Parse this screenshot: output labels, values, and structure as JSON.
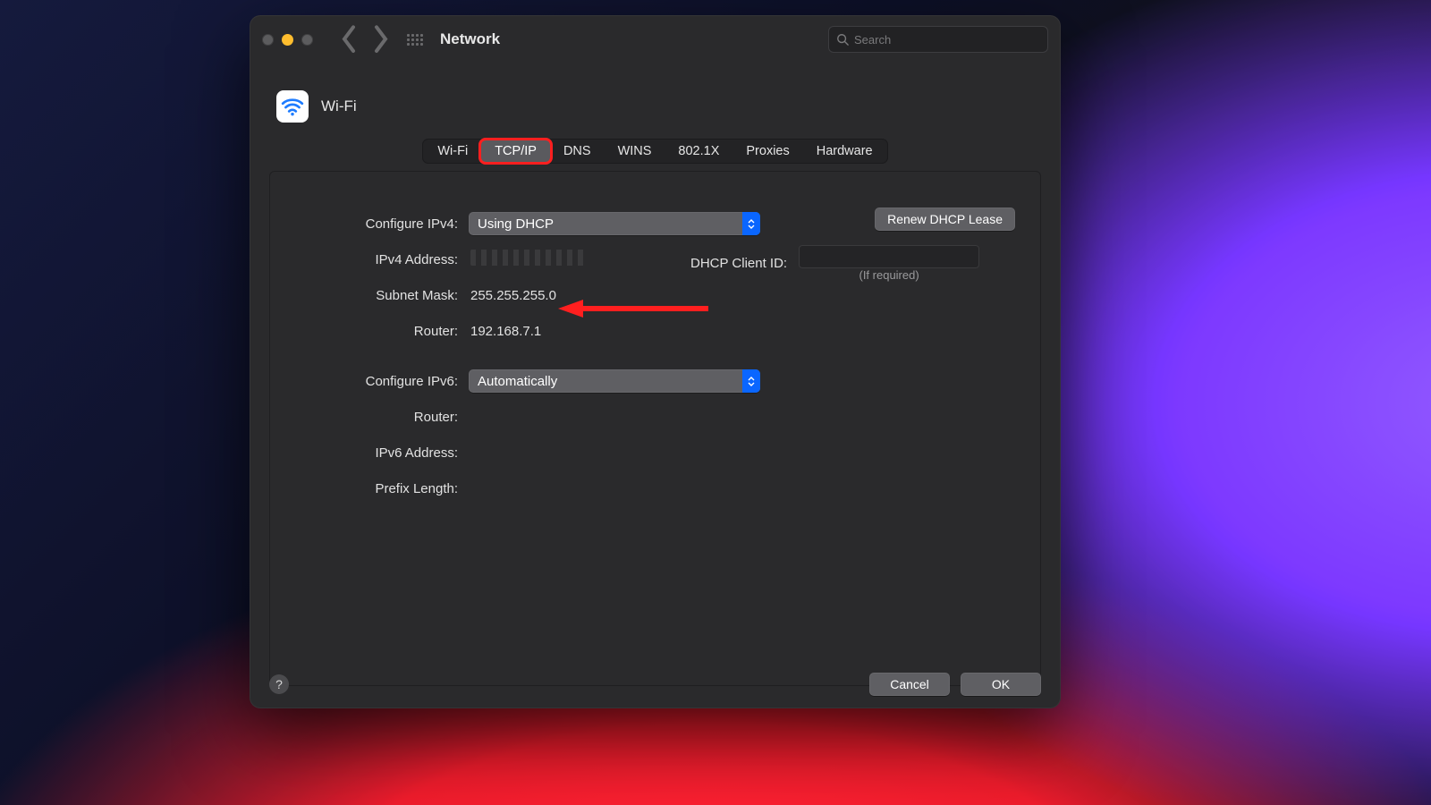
{
  "window": {
    "title": "Network"
  },
  "search": {
    "placeholder": "Search"
  },
  "header": {
    "interface": "Wi-Fi"
  },
  "tabs": [
    "Wi-Fi",
    "TCP/IP",
    "DNS",
    "WINS",
    "802.1X",
    "Proxies",
    "Hardware"
  ],
  "active_tab": "TCP/IP",
  "fields": {
    "configure_ipv4_label": "Configure IPv4:",
    "configure_ipv4_value": "Using DHCP",
    "ipv4_address_label": "IPv4 Address:",
    "ipv4_address_value": "",
    "subnet_label": "Subnet Mask:",
    "subnet_value": "255.255.255.0",
    "router_label": "Router:",
    "router_value": "192.168.7.1",
    "configure_ipv6_label": "Configure IPv6:",
    "configure_ipv6_value": "Automatically",
    "router6_label": "Router:",
    "ipv6_address_label": "IPv6 Address:",
    "prefix_label": "Prefix Length:"
  },
  "dhcp": {
    "renew_label": "Renew DHCP Lease",
    "client_id_label": "DHCP Client ID:",
    "note": "(If required)"
  },
  "footer": {
    "cancel": "Cancel",
    "ok": "OK"
  }
}
